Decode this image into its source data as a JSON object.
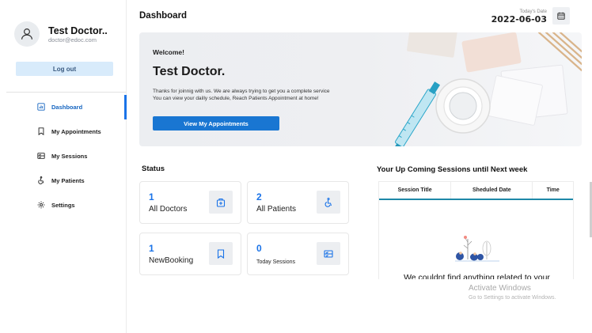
{
  "profile": {
    "name": "Test Doctor..",
    "email": "doctor@edoc.com",
    "logout_label": "Log out"
  },
  "sidebar": {
    "items": [
      {
        "label": "Dashboard",
        "icon": "dashboard-icon",
        "active": true
      },
      {
        "label": "My Appointments",
        "icon": "bookmark-icon",
        "active": false
      },
      {
        "label": "My Sessions",
        "icon": "sessions-icon",
        "active": false
      },
      {
        "label": "My Patients",
        "icon": "wheelchair-icon",
        "active": false
      },
      {
        "label": "Settings",
        "icon": "gear-icon",
        "active": false
      }
    ]
  },
  "header": {
    "title": "Dashboard",
    "date_label": "Today's Date",
    "date_value": "2022-06-03"
  },
  "banner": {
    "welcome": "Welcome!",
    "name": "Test Doctor.",
    "text_line1": "Thanks for joinnig with us. We are always trying to get you a complete service",
    "text_line2": "You can view your dailly schedule, Reach Patients Appointment at home!",
    "button_label": "View My Appointments"
  },
  "status": {
    "title": "Status",
    "cards": [
      {
        "value": "1",
        "label": "All Doctors",
        "icon": "doctor-icon"
      },
      {
        "value": "2",
        "label": "All Patients",
        "icon": "wheelchair-icon"
      },
      {
        "value": "1",
        "label": "NewBooking",
        "icon": "bookmark-icon"
      },
      {
        "value": "0",
        "label": "Today Sessions",
        "icon": "sessions-icon"
      }
    ]
  },
  "sessions": {
    "title": "Your Up Coming Sessions until Next week",
    "columns": [
      "Session Title",
      "Sheduled Date",
      "Time"
    ],
    "empty_text": "We couldnt find anything related to your"
  },
  "watermark": {
    "line1": "Activate Windows",
    "line2": "Go to Settings to activate Windows."
  },
  "colors": {
    "accent": "#1a73e8",
    "button": "#1976d2",
    "logout_bg": "#d8ebfb",
    "table_underline": "#1e88a8"
  }
}
